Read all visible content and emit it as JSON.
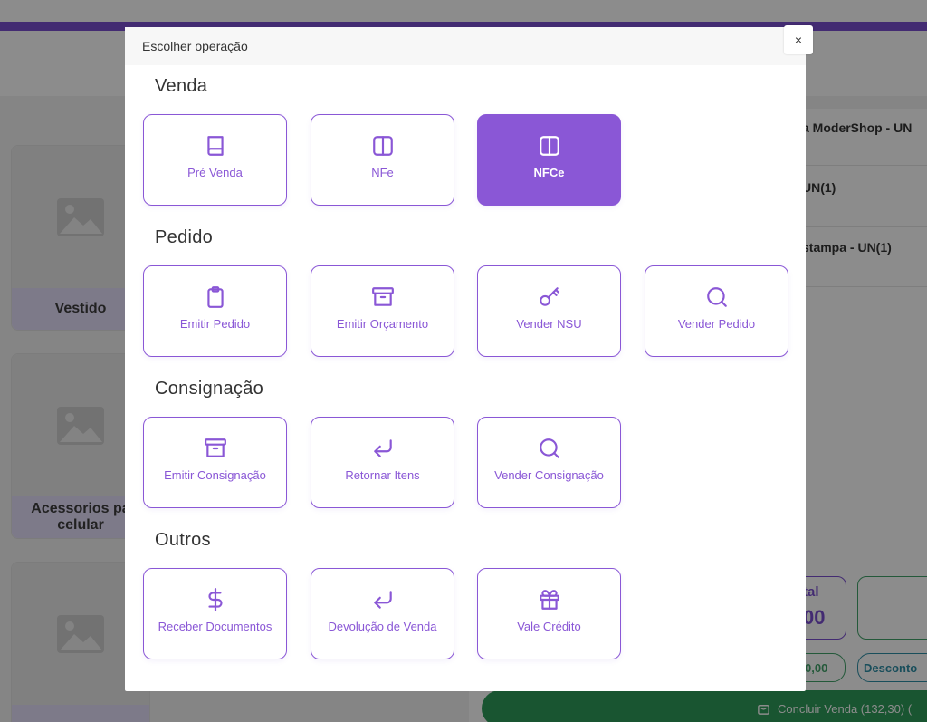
{
  "modal": {
    "title": "Escolher operação",
    "close_label": "×"
  },
  "sections": [
    {
      "title": "Venda",
      "buttons": [
        {
          "label": "Pré Venda",
          "icon": "book-icon",
          "active": false
        },
        {
          "label": "NFe",
          "icon": "columns-icon",
          "active": false
        },
        {
          "label": "NFCe",
          "icon": "columns-icon",
          "active": true
        }
      ]
    },
    {
      "title": "Pedido",
      "buttons": [
        {
          "label": "Emitir Pedido",
          "icon": "clipboard-icon",
          "active": false
        },
        {
          "label": "Emitir Orçamento",
          "icon": "archive-icon",
          "active": false
        },
        {
          "label": "Vender NSU",
          "icon": "key-icon",
          "active": false
        },
        {
          "label": "Vender Pedido",
          "icon": "search-icon",
          "active": false
        }
      ]
    },
    {
      "title": "Consignação",
      "buttons": [
        {
          "label": "Emitir Consignação",
          "icon": "archive-icon",
          "active": false
        },
        {
          "label": "Retornar Itens",
          "icon": "return-arrow-icon",
          "active": false
        },
        {
          "label": "Vender Consignação",
          "icon": "search-icon",
          "active": false
        }
      ]
    },
    {
      "title": "Outros",
      "buttons": [
        {
          "label": "Receber Documentos",
          "icon": "dollar-icon",
          "active": false
        },
        {
          "label": "Devolução de Venda",
          "icon": "return-arrow-icon",
          "active": false
        },
        {
          "label": "Vale Crédito",
          "icon": "gift-icon",
          "active": false
        }
      ]
    }
  ],
  "background": {
    "product_cards": [
      {
        "label": "Vestido"
      },
      {
        "label": "Acessorios pa celular"
      },
      {
        "label": ""
      }
    ],
    "cart_items": [
      {
        "text": "a ModerShop - UN"
      },
      {
        "text": "UN(1)"
      },
      {
        "text": "stampa - UN(1)"
      }
    ],
    "total_label": "tal",
    "total_value": "00",
    "amount_pill": "0,00",
    "discount_pill": "Desconto",
    "conclude_label": "Concluir Venda (132,30) ("
  },
  "colors": {
    "accent": "#8a57d6",
    "header_purple": "#7b4fd0",
    "success": "#2e9b5a"
  }
}
